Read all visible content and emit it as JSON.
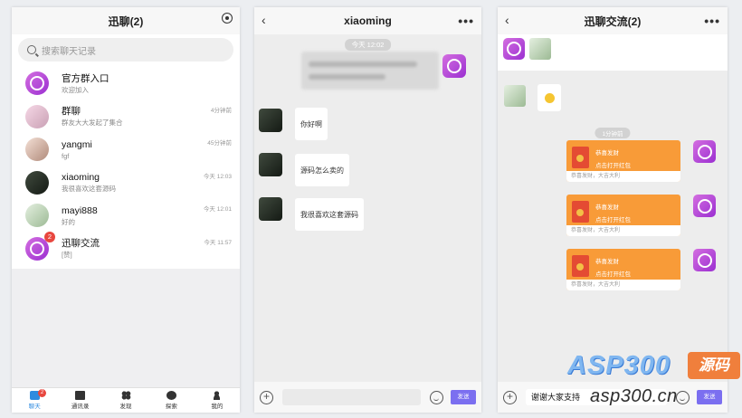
{
  "panel1": {
    "title": "迅聊(2)",
    "search_placeholder": "搜索聊天记录",
    "conversations": [
      {
        "name": "官方群入口",
        "last": "欢迎加入",
        "time": "",
        "avatar": "purple-logo"
      },
      {
        "name": "群聊",
        "last": "群友大大发起了集合",
        "time": "4分钟前",
        "avatar": "photo"
      },
      {
        "name": "yangmi",
        "last": "fgf",
        "time": "45分钟前",
        "avatar": "photo"
      },
      {
        "name": "xiaoming",
        "last": "我很喜欢这套源码",
        "time": "今天 12:03",
        "avatar": "dark-photo"
      },
      {
        "name": "mayi888",
        "last": "好的",
        "time": "今天 12:01",
        "avatar": "photo"
      },
      {
        "name": "迅聊交流",
        "last": "[赞]",
        "time": "今天 11:57",
        "avatar": "purple-logo",
        "badge": "2"
      }
    ],
    "nav": [
      {
        "label": "聊天",
        "icon": "chat-icon",
        "badge": "2",
        "active": true
      },
      {
        "label": "通讯录",
        "icon": "contacts-icon"
      },
      {
        "label": "发现",
        "icon": "discover-icon"
      },
      {
        "label": "探索",
        "icon": "explore-icon"
      },
      {
        "label": "我的",
        "icon": "profile-icon"
      }
    ]
  },
  "panel2": {
    "title": "xiaoming",
    "time_pill": "今天 12:02",
    "messages": [
      {
        "text": "你好啊"
      },
      {
        "text": "源码怎么卖的"
      },
      {
        "text": "我很喜欢这套源码"
      }
    ],
    "send_label": "发送",
    "input_value": ""
  },
  "panel3": {
    "title": "迅聊交流(2)",
    "time_pill": "1分钟前",
    "red_packets": [
      {
        "title": "恭喜发财",
        "subtitle": "点击打开红包",
        "footer": "恭喜发财，大吉大利"
      },
      {
        "title": "恭喜发财",
        "subtitle": "点击打开红包",
        "footer": "恭喜发财，大吉大利"
      },
      {
        "title": "恭喜发财",
        "subtitle": "点击打开红包",
        "footer": "恭喜发财，大吉大利"
      }
    ],
    "input_value": "谢谢大家支持",
    "send_label": "发送"
  },
  "watermark": {
    "brand": "ASP300",
    "tag": "源码",
    "url": "asp300.cn"
  }
}
